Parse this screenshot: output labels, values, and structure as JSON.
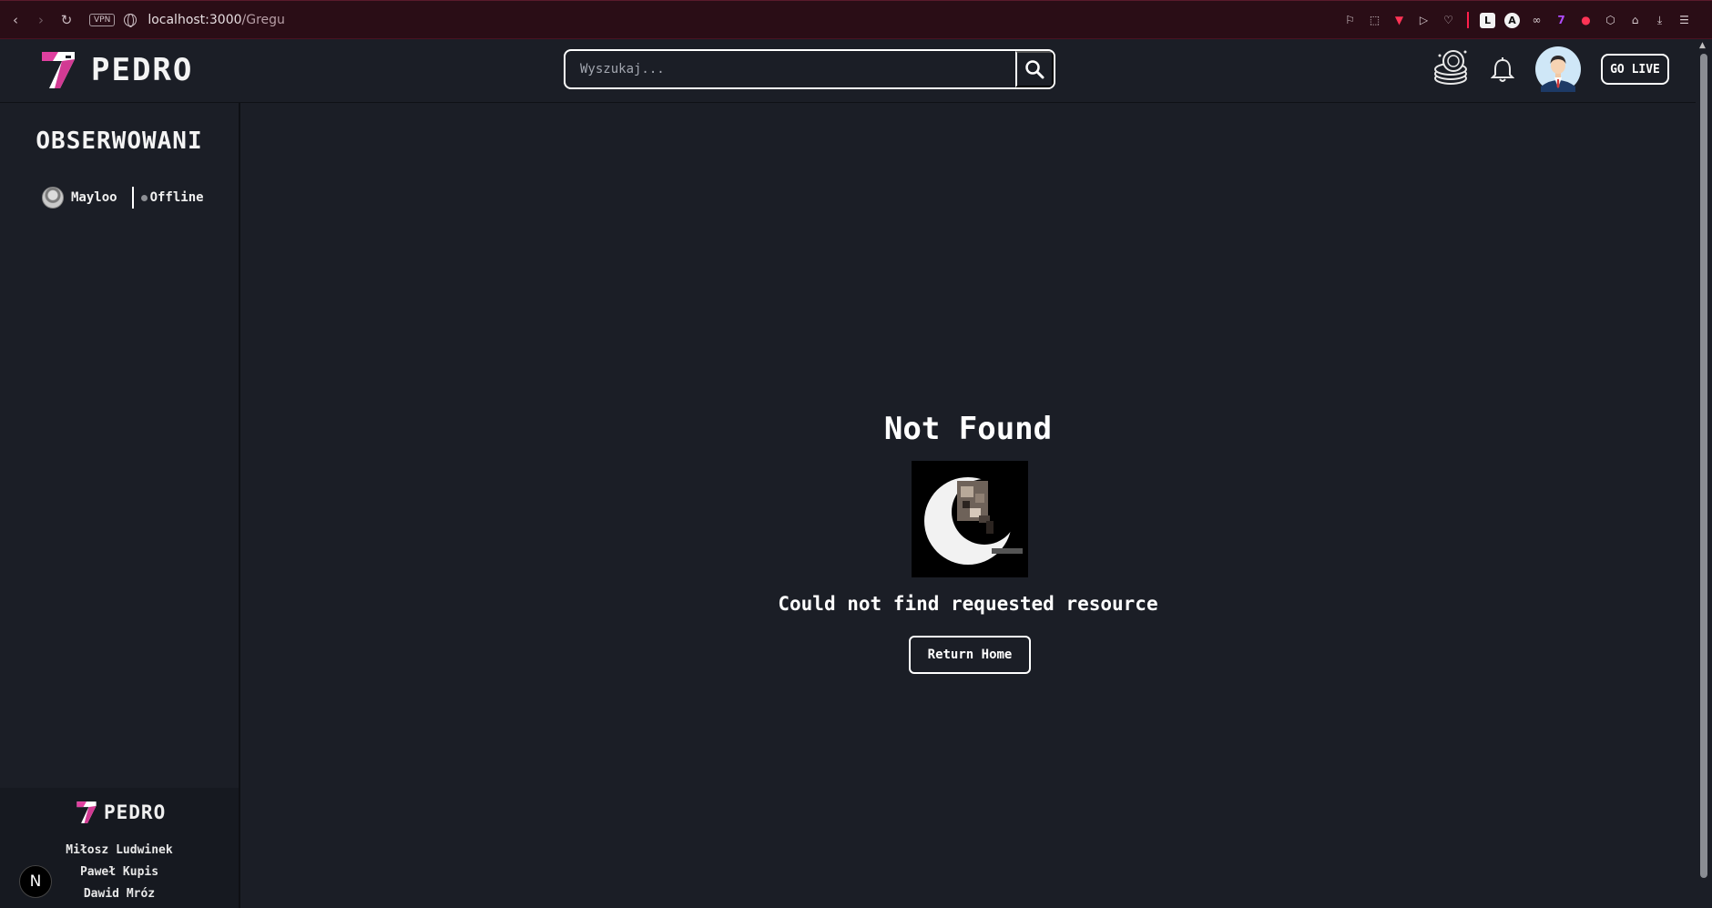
{
  "browser": {
    "url_host": "localhost:3000",
    "url_path": "/Gregu",
    "vpn_label": "VPN",
    "icons": [
      "back-icon",
      "forward-icon",
      "reload-icon",
      "globe-icon"
    ],
    "extensions": [
      "bookmark-icon",
      "screenshot-icon",
      "pocket-icon",
      "play-icon",
      "heart-icon",
      "extension-l-icon",
      "extension-a-icon",
      "extension-glasses-icon",
      "extension-purple-icon",
      "extension-red-icon",
      "puzzle-icon",
      "profile-icon",
      "download-icon",
      "menu-icon"
    ]
  },
  "header": {
    "logo_text": "PEDRO",
    "search_placeholder": "Wyszukaj...",
    "go_live_label": "GO LIVE",
    "icons": [
      "coins-icon",
      "bell-icon",
      "avatar"
    ]
  },
  "sidebar": {
    "title": "OBSERWOWANI",
    "followed": [
      {
        "name": "Mayloo",
        "status": "Offline",
        "status_color": "#8d8f94"
      }
    ],
    "footer": {
      "logo_text": "PEDRO",
      "authors": [
        "Miłosz Ludwinek",
        "Paweł Kupis",
        "Dawid Mróz"
      ],
      "badge": "N"
    }
  },
  "main": {
    "title": "Not Found",
    "message": "Could not find requested resource",
    "return_label": "Return Home"
  },
  "colors": {
    "background": "#1b1e26",
    "accent_pink": "#e040a0",
    "browser_bar": "#2a0d16"
  }
}
